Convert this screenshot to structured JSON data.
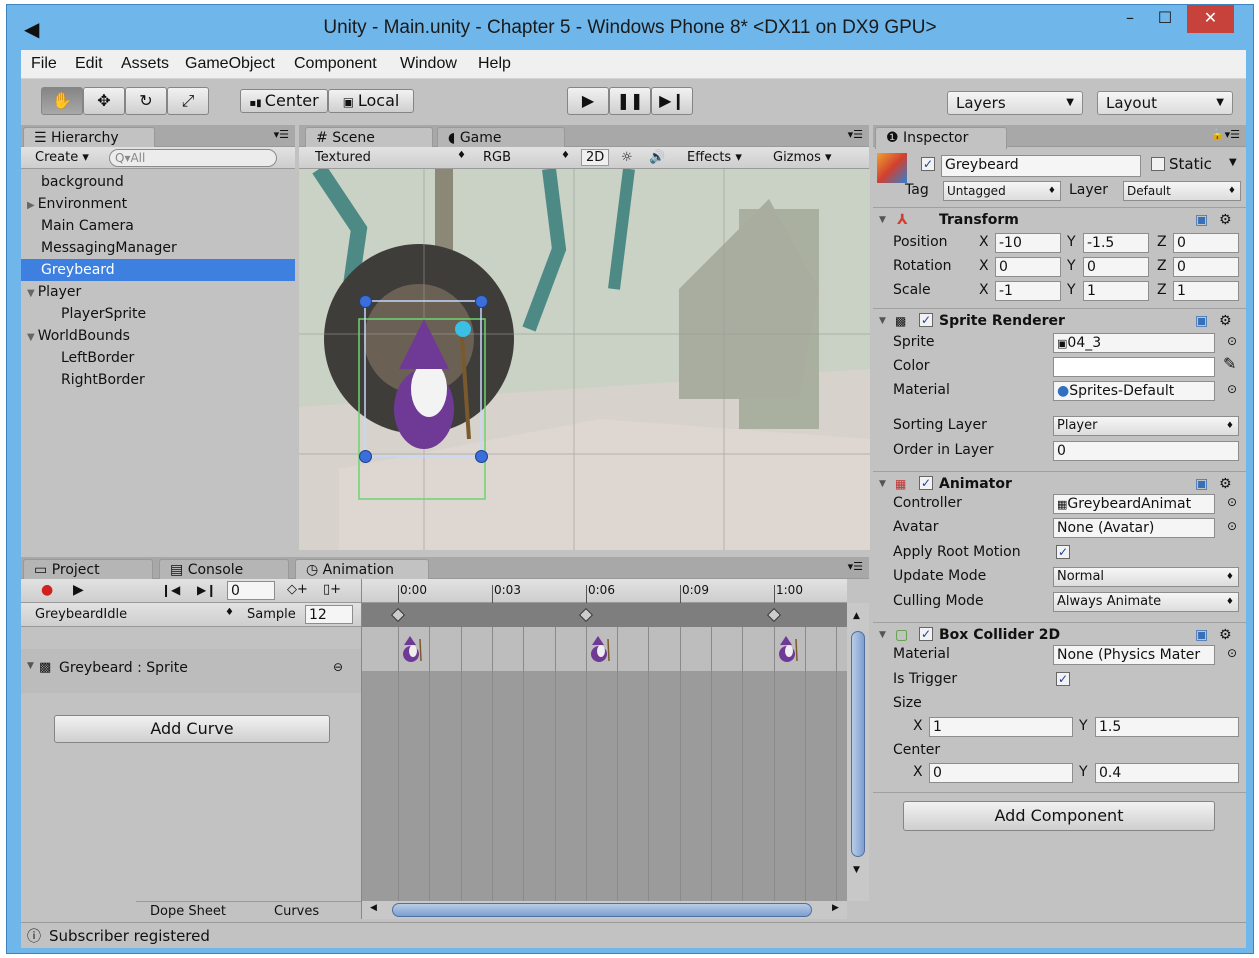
{
  "window": {
    "title": "Unity - Main.unity - Chapter 5 - Windows Phone 8* <DX11 on DX9 GPU>",
    "controls": [
      "–",
      "☐",
      "✕"
    ]
  },
  "menu": [
    "File",
    "Edit",
    "Assets",
    "GameObject",
    "Component",
    "Window",
    "Help"
  ],
  "toolbar": {
    "pivot": "Center",
    "space": "Local",
    "layers": "Layers",
    "layout": "Layout"
  },
  "hierarchy": {
    "tab": "Hierarchy",
    "create": "Create",
    "search": "Q▾All",
    "items": [
      {
        "label": "background",
        "indent": 0,
        "arrow": ""
      },
      {
        "label": "Environment",
        "indent": 0,
        "arrow": "▶"
      },
      {
        "label": "Main Camera",
        "indent": 0,
        "arrow": ""
      },
      {
        "label": "MessagingManager",
        "indent": 0,
        "arrow": ""
      },
      {
        "label": "Greybeard",
        "indent": 0,
        "arrow": "",
        "selected": true
      },
      {
        "label": "Player",
        "indent": 0,
        "arrow": "▼"
      },
      {
        "label": "PlayerSprite",
        "indent": 1,
        "arrow": ""
      },
      {
        "label": "WorldBounds",
        "indent": 0,
        "arrow": "▼"
      },
      {
        "label": "LeftBorder",
        "indent": 1,
        "arrow": ""
      },
      {
        "label": "RightBorder",
        "indent": 1,
        "arrow": ""
      }
    ]
  },
  "scene": {
    "tab_scene": "Scene",
    "tab_game": "Game",
    "shading": "Textured",
    "channel": "RGB",
    "mode2d": "2D",
    "effects": "Effects",
    "gizmos": "Gizmos"
  },
  "bottom": {
    "tab_project": "Project",
    "tab_console": "Console",
    "tab_animation": "Animation",
    "frame": "0",
    "clip": "GreybeardIdle",
    "sample_label": "Sample",
    "sample": "12",
    "track": "Greybeard : Sprite",
    "add_curve": "Add Curve",
    "timeline": [
      "0:00",
      "0:03",
      "0:06",
      "0:09",
      "1:00"
    ],
    "dopesheet": "Dope Sheet",
    "curves": "Curves"
  },
  "status": "Subscriber registered",
  "inspector": {
    "tab": "Inspector",
    "name": "Greybeard",
    "static": "Static",
    "tag_label": "Tag",
    "tag": "Untagged",
    "layer_label": "Layer",
    "layer": "Default",
    "transform": {
      "title": "Transform",
      "rows": [
        {
          "label": "Position",
          "x": "-10",
          "y": "-1.5",
          "z": "0"
        },
        {
          "label": "Rotation",
          "x": "0",
          "y": "0",
          "z": "0"
        },
        {
          "label": "Scale",
          "x": "-1",
          "y": "1",
          "z": "1"
        }
      ]
    },
    "sprite_renderer": {
      "title": "Sprite Renderer",
      "sprite_label": "Sprite",
      "sprite": "04_3",
      "color_label": "Color",
      "material_label": "Material",
      "material": "Sprites-Default",
      "sorting_label": "Sorting Layer",
      "sorting": "Player",
      "order_label": "Order in Layer",
      "order": "0"
    },
    "animator": {
      "title": "Animator",
      "controller_label": "Controller",
      "controller": "GreybeardAnimat",
      "avatar_label": "Avatar",
      "avatar": "None (Avatar)",
      "root_label": "Apply Root Motion",
      "update_label": "Update Mode",
      "update": "Normal",
      "culling_label": "Culling Mode",
      "culling": "Always Animate"
    },
    "box": {
      "title": "Box Collider 2D",
      "material_label": "Material",
      "material": "None (Physics Mater",
      "trigger_label": "Is Trigger",
      "size_label": "Size",
      "size_x": "1",
      "size_y": "1.5",
      "center_label": "Center",
      "center_x": "0",
      "center_y": "0.4"
    },
    "add_component": "Add Component"
  },
  "axis": {
    "x": "X",
    "y": "Y",
    "z": "Z"
  },
  "colors": {
    "selection": "#3d80df",
    "titlebar": "#6fb6ea",
    "close": "#c7423a"
  }
}
